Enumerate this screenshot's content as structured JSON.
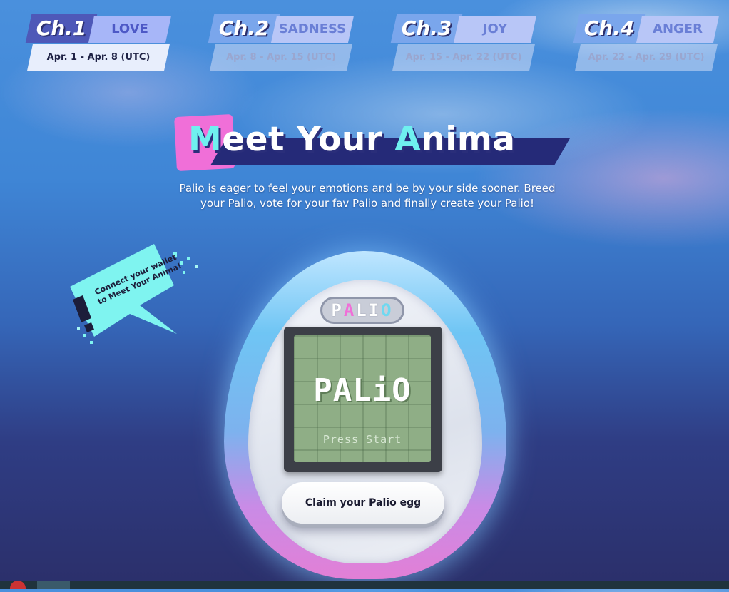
{
  "chapters": [
    {
      "number": "Ch.1",
      "emotion": "LOVE",
      "dates": "Apr. 1 - Apr. 8 (UTC)",
      "active": true
    },
    {
      "number": "Ch.2",
      "emotion": "SADNESS",
      "dates": "Apr. 8 - Apr. 15 (UTC)",
      "active": false
    },
    {
      "number": "Ch.3",
      "emotion": "JOY",
      "dates": "Apr. 15 - Apr. 22 (UTC)",
      "active": false
    },
    {
      "number": "Ch.4",
      "emotion": "ANGER",
      "dates": "Apr. 22 - Apr. 29 (UTC)",
      "active": false
    }
  ],
  "hero": {
    "title_hl1": "M",
    "title_p1": "eet Your ",
    "title_hl2": "A",
    "title_p2": "nima",
    "subtitle_line1": "Palio is eager to feel your emotions and be by your side sooner. Breed",
    "subtitle_line2": "your Palio, vote for your fav Palio and finally create your Palio!"
  },
  "speech_bubble": {
    "text": "Connect your wallet to Meet Your Anima!"
  },
  "device": {
    "logo_1": "P",
    "logo_2": "A",
    "logo_3": "LI",
    "logo_4": "O",
    "screen_title": "PALiO",
    "screen_prompt": "Press Start",
    "claim_button": "Claim your Palio egg"
  },
  "colors": {
    "accent_pink": "#f06fd8",
    "accent_cyan": "#6ff0ef",
    "chapter_active": "#4e58b8",
    "chapter_label": "#a7b6f8"
  },
  "icons": {
    "bubble_mark": "exclamation-icon"
  }
}
